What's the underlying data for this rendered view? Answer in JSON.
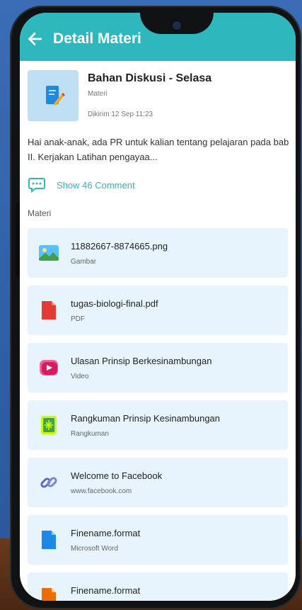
{
  "appbar": {
    "title": "Detail Materi"
  },
  "post": {
    "title": "Bahan Diskusi - Selasa",
    "subtitle": "Materi",
    "sent": "Dikirim 12 Sep 11:23",
    "description": "Hai anak-anak, ada PR untuk kalian tentang pelajaran pada bab II. Kerjakan Latihan pengayaa...",
    "comment_link": "Show 46 Comment"
  },
  "section_label": "Materi",
  "items": [
    {
      "name": "11882667-8874665.png",
      "type": "Gambar",
      "icon": "image-icon"
    },
    {
      "name": "tugas-biologi-final.pdf",
      "type": "PDF",
      "icon": "pdf-file-icon"
    },
    {
      "name": "Ulasan Prinsip Berkesinambungan",
      "type": "Video",
      "icon": "video-icon"
    },
    {
      "name": "Rangkuman Prinsip Kesinambungan",
      "type": "Rangkuman",
      "icon": "summary-icon"
    },
    {
      "name": "Welcome to Facebook",
      "type": "www.facebook.com",
      "icon": "link-icon"
    },
    {
      "name": "Finename.format",
      "type": "Microsoft Word",
      "icon": "word-file-icon"
    },
    {
      "name": "Finename.format",
      "type": "",
      "icon": "file-icon"
    }
  ],
  "colors": {
    "primary": "#2eb7bd",
    "card": "#e8f4fd",
    "thumb": "#bfe0f4"
  }
}
